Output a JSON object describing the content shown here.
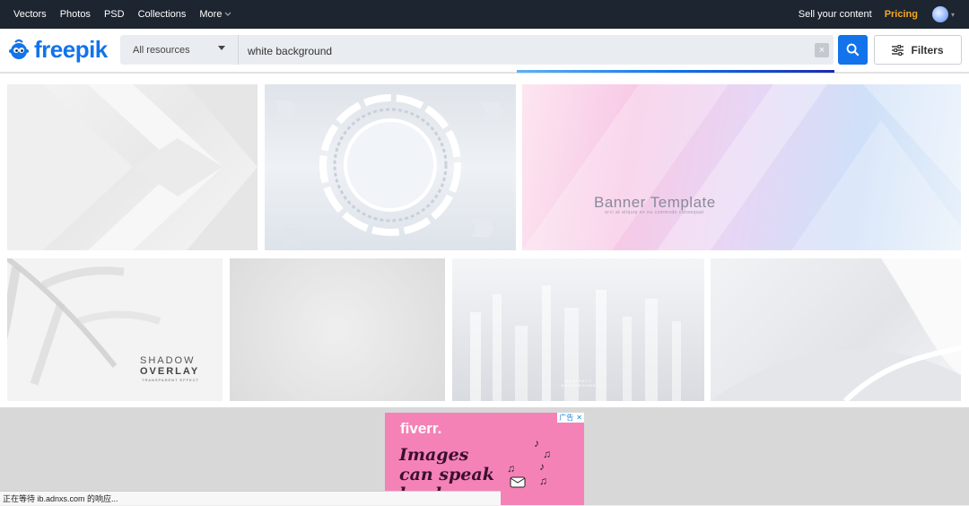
{
  "topnav": {
    "items": [
      "Vectors",
      "Photos",
      "PSD",
      "Collections"
    ],
    "more_label": "More",
    "sell_label": "Sell your content",
    "pricing_label": "Pricing",
    "pricing_color": "#f5a623"
  },
  "search": {
    "logo_text": "freepik",
    "resource_type": "All resources",
    "query": "white background",
    "clear_label": "×",
    "filters_label": "Filters",
    "accent_color": "#1273eb"
  },
  "gallery": {
    "banner_title": "Banner Template",
    "banner_subtitle": "orci at aliquip ex ea commodo consequat",
    "shadow_line1": "SHADOW",
    "shadow_line2": "OVERLAY",
    "shadow_line3": "TRANSPARENT EFFECT",
    "abstract_label": "ABSTRACT BACKGROUND"
  },
  "ad": {
    "brand": "fiverr.",
    "headline": "Images can speak louder",
    "badge": "广告"
  },
  "status": {
    "text": "正在等待 ib.adnxs.com 的响应..."
  }
}
